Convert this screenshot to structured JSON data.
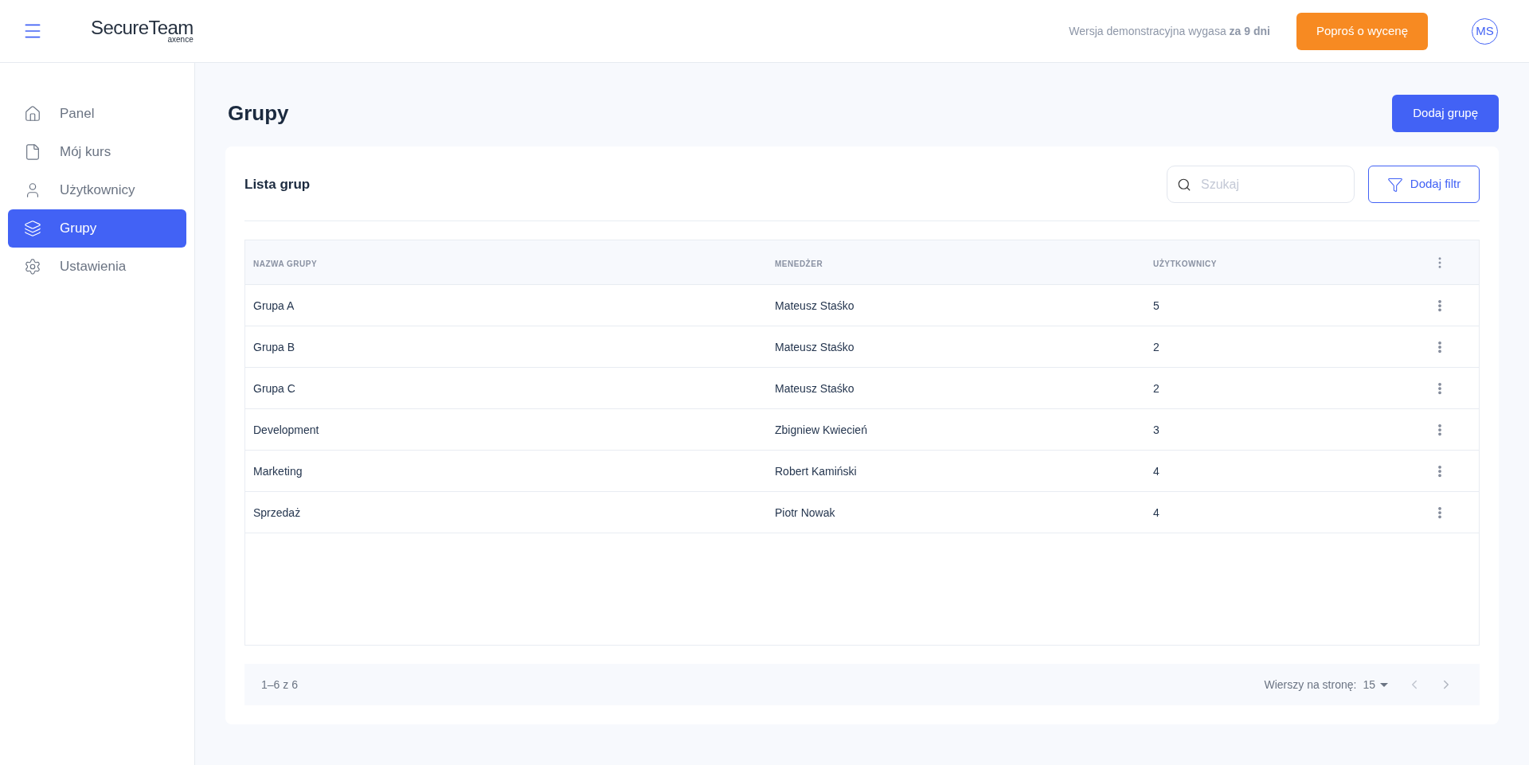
{
  "header": {
    "logo": {
      "name": "SecureTeam",
      "sub": "axence"
    },
    "trial_text": "Wersja demonstracyjna wygasa **za 9 dni**",
    "quote_button": "Poproś o wycenę",
    "avatar": "MS"
  },
  "sidebar": {
    "items": [
      {
        "label": "Panel",
        "selected": false
      },
      {
        "label": "Mój kurs",
        "selected": false
      },
      {
        "label": "Użytkownicy",
        "selected": false
      },
      {
        "label": "Grupy",
        "selected": true
      },
      {
        "label": "Ustawienia",
        "selected": false
      }
    ]
  },
  "page": {
    "title": "Grupy",
    "add_button": "Dodaj grupę"
  },
  "card": {
    "title": "Lista grup",
    "search": {
      "placeholder": "Szukaj"
    },
    "filter_button": "Dodaj filtr"
  },
  "table": {
    "columns": [
      "NAZWA GRUPY",
      "MENEDŻER",
      "UŻYTKOWNICY"
    ],
    "rows": [
      [
        "Grupa A",
        "Mateusz Staśko",
        "5"
      ],
      [
        "Grupa B",
        "Mateusz Staśko",
        "2"
      ],
      [
        "Grupa C",
        "Mateusz Staśko",
        "2"
      ],
      [
        "Development",
        "Zbigniew Kwiecień",
        "3"
      ],
      [
        "Marketing",
        "Robert Kamiński",
        "4"
      ],
      [
        "Sprzedaż",
        "Piotr Nowak",
        "4"
      ]
    ]
  },
  "pagination": {
    "range": "1–6 z 6",
    "rows_per_page_label": "Wierszy na stronę:",
    "rows_per_page": "15"
  }
}
